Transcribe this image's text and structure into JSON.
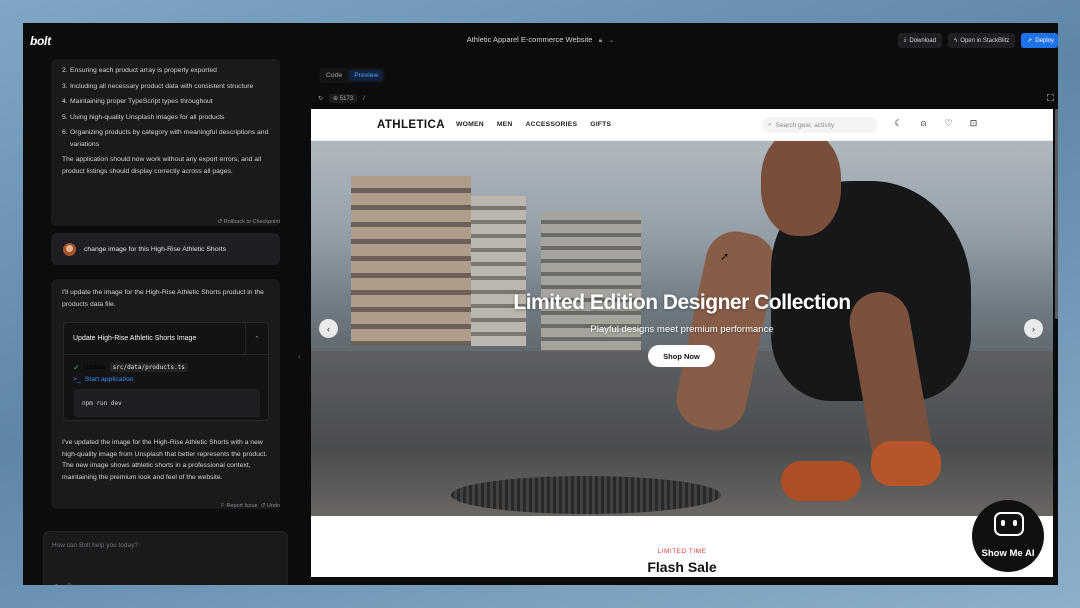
{
  "app": {
    "logo": "bolt",
    "project_title": "Athletic Apparel E-commerce Website",
    "buttons": {
      "download": "Download",
      "stackblitz": "Open in StackBlitz",
      "deploy": "Deploy"
    }
  },
  "chat": {
    "list_items": [
      {
        "n": "2.",
        "text": "Ensuring each product array is properly exported"
      },
      {
        "n": "3.",
        "text": "Including all necessary product data with consistent structure"
      },
      {
        "n": "4.",
        "text": "Maintaining proper TypeScript types throughout"
      },
      {
        "n": "5.",
        "text": "Using high-quality Unsplash images for all products"
      },
      {
        "n": "6.",
        "text": "Organizing products by category with meaningful descriptions and variations"
      }
    ],
    "summary": "The application should now work without any export errors, and all product listings should display correctly across all pages.",
    "rollback": "Rollback to Checkpoint",
    "user_message": "change image for this High-Rise Athletic Shorts",
    "assistant_intro": "I'll update the image for the High-Rise Athletic Shorts product in the products data file.",
    "action": {
      "title": "Update High-Rise Athletic Shorts Image",
      "update_label": "Update",
      "file": "src/data/products.ts",
      "start_label": "Start application",
      "command": "npm run dev"
    },
    "assistant_outro": "I've updated the image for the High-Rise Athletic Shorts with a new high-quality image from Unsplash that better represents the product. The new image shows athletic shorts in a professional context, maintaining the premium look and feel of the website.",
    "report_issue": "Report Issue",
    "undo": "Undo",
    "input_placeholder": "How can Bolt help you today?"
  },
  "preview": {
    "tabs": [
      "Code",
      "Preview"
    ],
    "active_tab": "Preview",
    "port": "5173",
    "path": "/"
  },
  "site": {
    "brand": "ATHLETICA",
    "nav": [
      "WOMEN",
      "MEN",
      "ACCESSORIES",
      "GIFTS"
    ],
    "search_placeholder": "Search gear, activity",
    "hero_title": "Limited Edition Designer Collection",
    "hero_subtitle": "Playful designs meet premium performance",
    "hero_button": "Shop Now",
    "flash_label": "LIMITED TIME",
    "flash_title": "Flash Sale"
  },
  "watermark": {
    "text": "Show Me AI"
  },
  "icons": {
    "moon": "moon-icon",
    "user": "user-icon",
    "heart": "heart-icon",
    "bag": "shopping-bag-icon",
    "search": "search-icon",
    "refresh": "refresh-icon",
    "rocket": "rocket-icon",
    "bolt": "bolt-icon"
  },
  "colors": {
    "deploy": "#1d72e8",
    "accent_link": "#3b8cf5",
    "flash": "#e53e3e",
    "check": "#22c55e"
  }
}
